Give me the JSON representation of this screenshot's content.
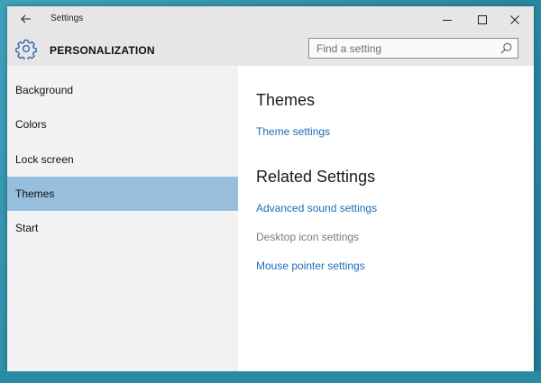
{
  "window": {
    "title": "Settings"
  },
  "header": {
    "section_title": "PERSONALIZATION",
    "search_placeholder": "Find a setting"
  },
  "sidebar": {
    "items": [
      {
        "label": "Background"
      },
      {
        "label": "Colors"
      },
      {
        "label": "Lock screen"
      },
      {
        "label": "Themes",
        "selected": true
      },
      {
        "label": "Start"
      }
    ]
  },
  "main": {
    "themes_heading": "Themes",
    "theme_settings_link": "Theme settings",
    "related_heading": "Related Settings",
    "related_links": [
      {
        "label": "Advanced sound settings",
        "enabled": true
      },
      {
        "label": "Desktop icon settings",
        "enabled": false
      },
      {
        "label": "Mouse pointer settings",
        "enabled": true
      }
    ]
  },
  "colors": {
    "accent_selected": "#97bedd",
    "link": "#1c6eb5",
    "desktop": "#2e8fa8"
  },
  "icons": [
    "back-arrow-icon",
    "minimize-icon",
    "maximize-icon",
    "close-icon",
    "gear-icon",
    "search-icon"
  ]
}
